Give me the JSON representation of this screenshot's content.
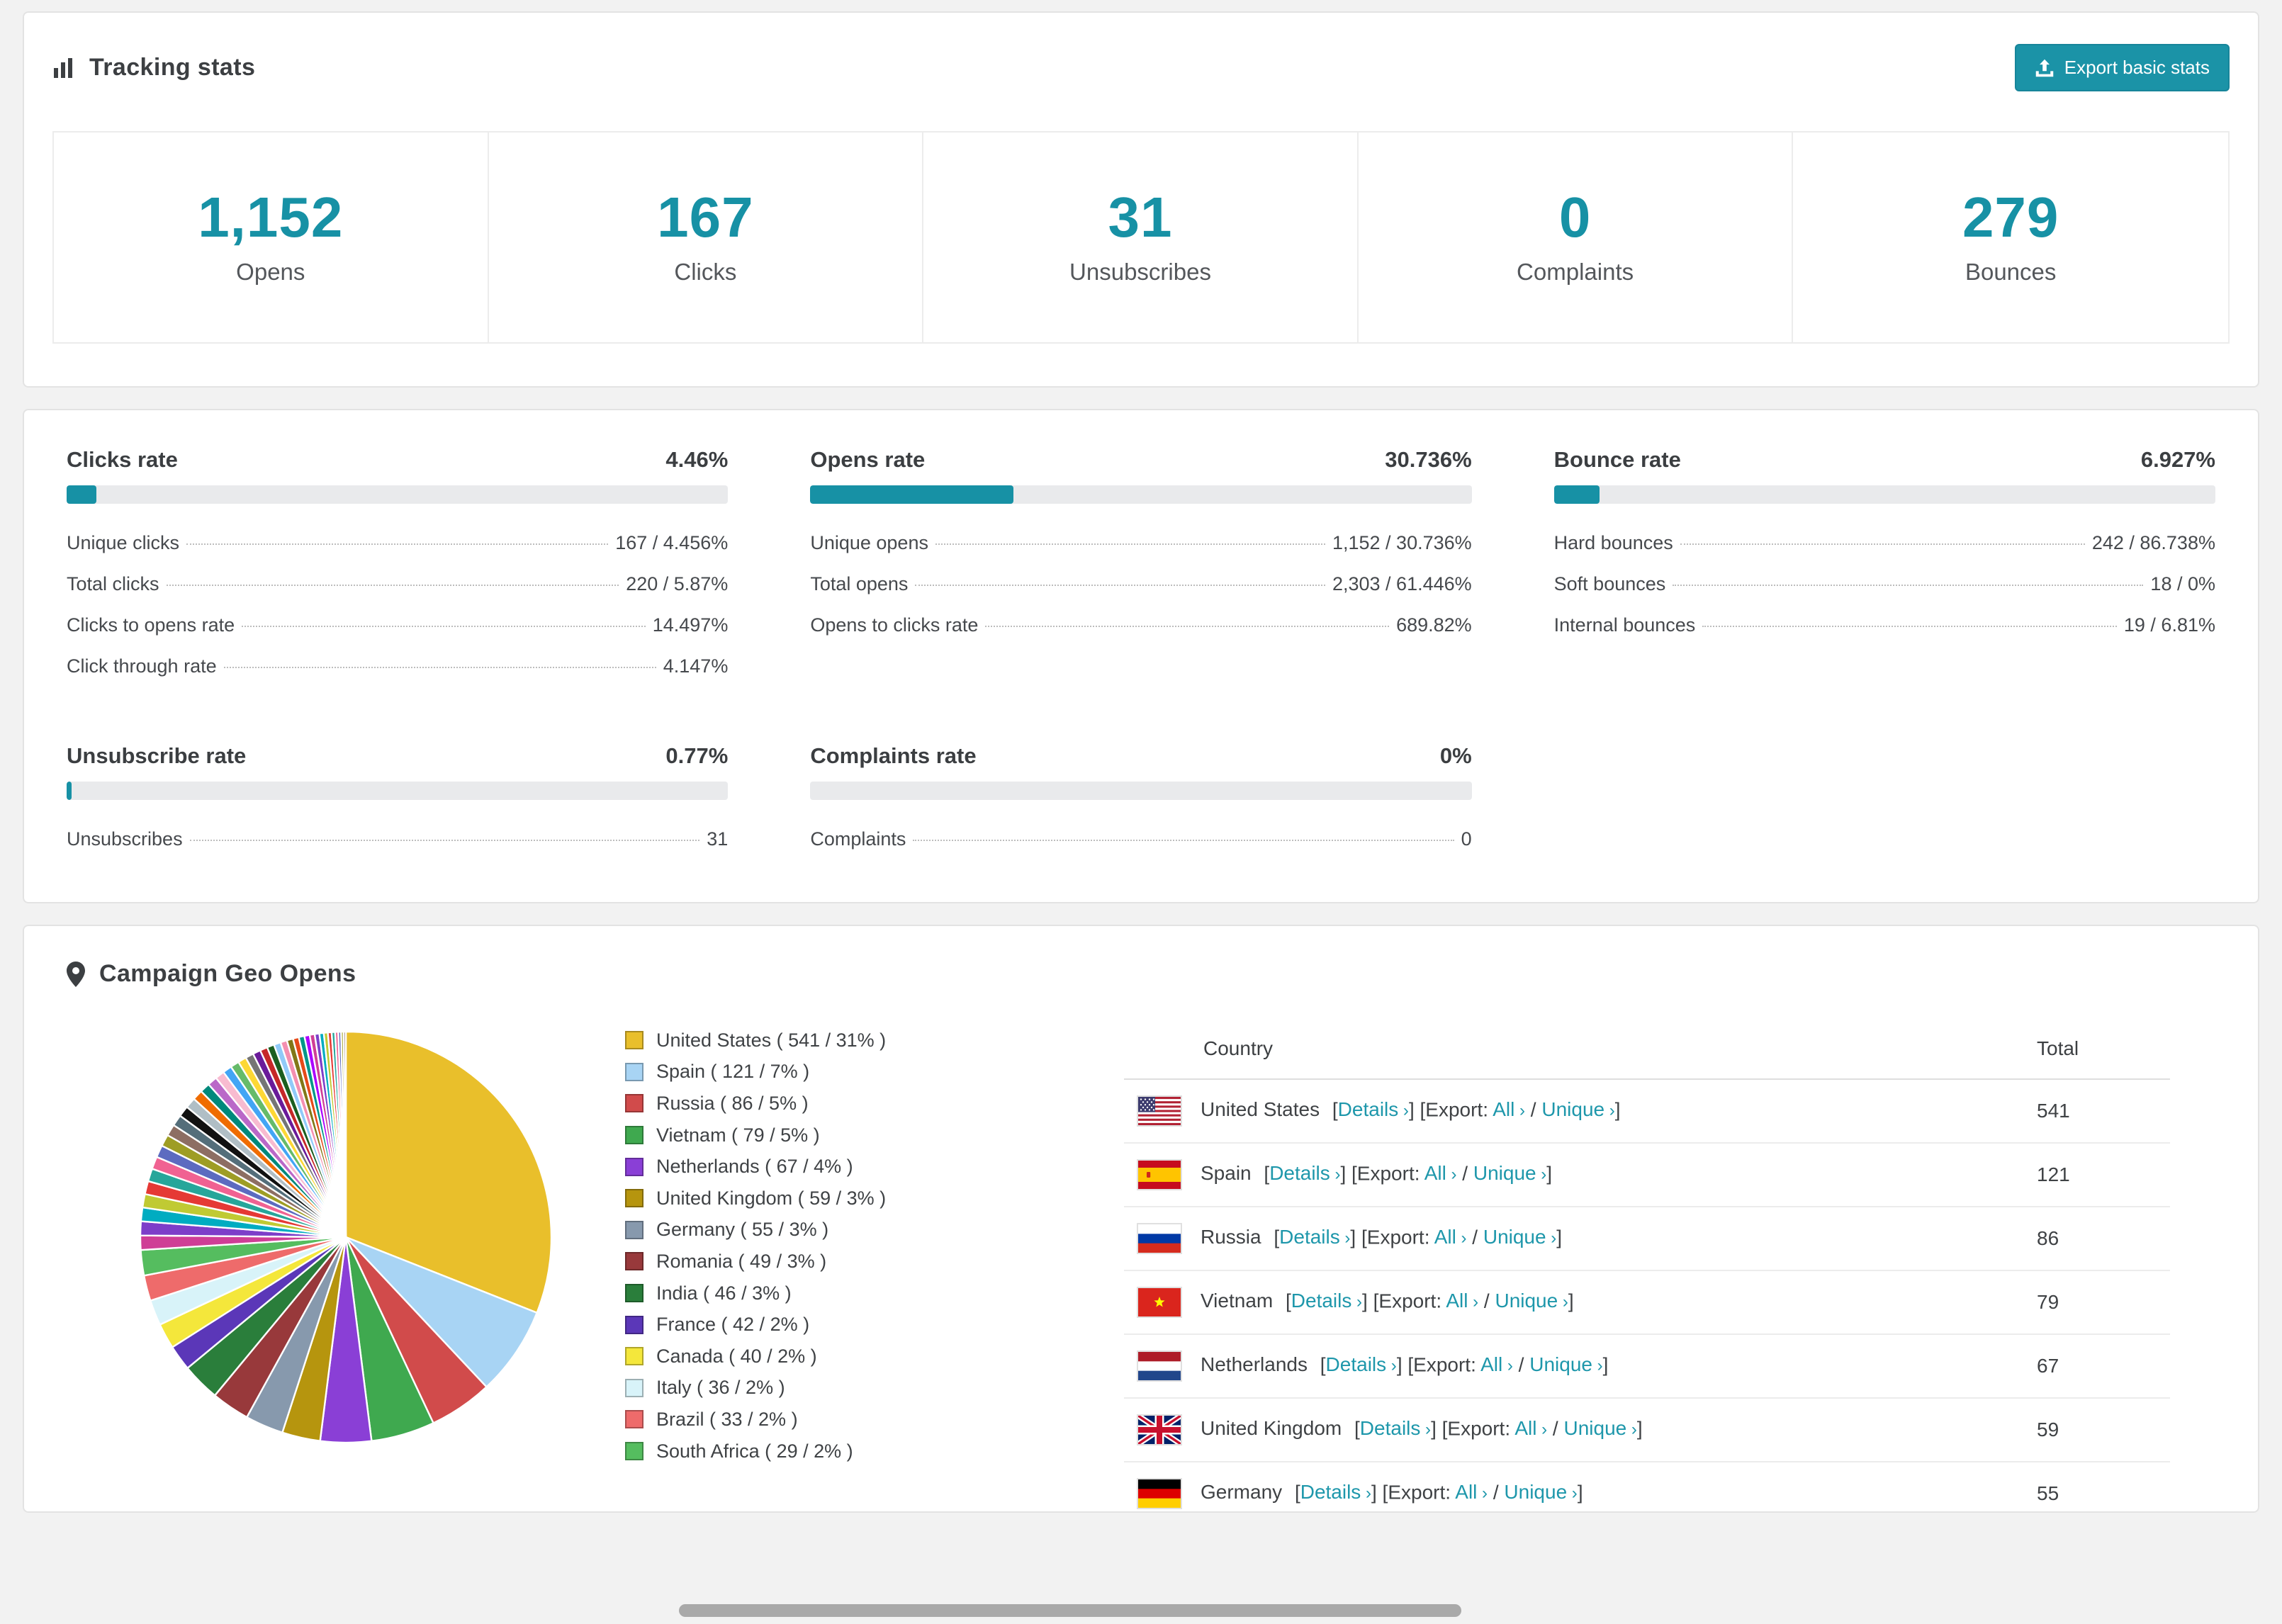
{
  "theme": {
    "accent": "#1791a5",
    "link": "#1e97ab",
    "text": "#3f4245"
  },
  "tracking": {
    "title": "Tracking stats",
    "export_button_label": "Export basic stats",
    "stats": [
      {
        "value": "1,152",
        "label": "Opens"
      },
      {
        "value": "167",
        "label": "Clicks"
      },
      {
        "value": "31",
        "label": "Unsubscribes"
      },
      {
        "value": "0",
        "label": "Complaints"
      },
      {
        "value": "279",
        "label": "Bounces"
      }
    ]
  },
  "rates": [
    {
      "title": "Clicks rate",
      "value": "4.46%",
      "pct": 4.46,
      "rows": [
        {
          "label": "Unique clicks",
          "value": "167 / 4.456%"
        },
        {
          "label": "Total clicks",
          "value": "220 / 5.87%"
        },
        {
          "label": "Clicks to opens rate",
          "value": "14.497%"
        },
        {
          "label": "Click through rate",
          "value": "4.147%"
        }
      ]
    },
    {
      "title": "Opens rate",
      "value": "30.736%",
      "pct": 30.736,
      "rows": [
        {
          "label": "Unique opens",
          "value": "1,152 / 30.736%"
        },
        {
          "label": "Total opens",
          "value": "2,303 / 61.446%"
        },
        {
          "label": "Opens to clicks rate",
          "value": "689.82%"
        }
      ]
    },
    {
      "title": "Bounce rate",
      "value": "6.927%",
      "pct": 6.927,
      "rows": [
        {
          "label": "Hard bounces",
          "value": "242 / 86.738%"
        },
        {
          "label": "Soft bounces",
          "value": "18 / 0%"
        },
        {
          "label": "Internal bounces",
          "value": "19 / 6.81%"
        }
      ]
    },
    {
      "title": "Unsubscribe rate",
      "value": "0.77%",
      "pct": 0.77,
      "rows": [
        {
          "label": "Unsubscribes",
          "value": "31"
        }
      ]
    },
    {
      "title": "Complaints rate",
      "value": "0%",
      "pct": 0,
      "rows": [
        {
          "label": "Complaints",
          "value": "0"
        }
      ]
    }
  ],
  "geo": {
    "title": "Campaign Geo Opens",
    "table_headers": {
      "country": "Country",
      "total": "Total"
    },
    "link_labels": {
      "details": "Details",
      "export": "Export:",
      "all": "All",
      "unique": "Unique"
    },
    "rows": [
      {
        "flag": "us",
        "country": "United States",
        "total": "541"
      },
      {
        "flag": "es",
        "country": "Spain",
        "total": "121"
      },
      {
        "flag": "ru",
        "country": "Russia",
        "total": "86"
      },
      {
        "flag": "vn",
        "country": "Vietnam",
        "total": "79"
      },
      {
        "flag": "nl",
        "country": "Netherlands",
        "total": "67"
      },
      {
        "flag": "gb",
        "country": "United Kingdom",
        "total": "59"
      },
      {
        "flag": "de",
        "country": "Germany",
        "total": "55"
      }
    ]
  },
  "chart_data": {
    "type": "pie",
    "title": "Campaign Geo Opens",
    "legend_position": "right",
    "slices": [
      {
        "label": "United States",
        "count": 541,
        "pct": 31,
        "color": "#e9bf2b"
      },
      {
        "label": "Spain",
        "count": 121,
        "pct": 7,
        "color": "#a8d4f4"
      },
      {
        "label": "Russia",
        "count": 86,
        "pct": 5,
        "color": "#d14b4b"
      },
      {
        "label": "Vietnam",
        "count": 79,
        "pct": 5,
        "color": "#3fa94f"
      },
      {
        "label": "Netherlands",
        "count": 67,
        "pct": 4,
        "color": "#8a3fd6"
      },
      {
        "label": "United Kingdom",
        "count": 59,
        "pct": 3,
        "color": "#b6950e"
      },
      {
        "label": "Germany",
        "count": 55,
        "pct": 3,
        "color": "#8799ad"
      },
      {
        "label": "Romania",
        "count": 49,
        "pct": 3,
        "color": "#98393b"
      },
      {
        "label": "India",
        "count": 46,
        "pct": 3,
        "color": "#2a7e3b"
      },
      {
        "label": "France",
        "count": 42,
        "pct": 2,
        "color": "#5b37b8"
      },
      {
        "label": "Canada",
        "count": 40,
        "pct": 2,
        "color": "#f4e73b"
      },
      {
        "label": "Italy",
        "count": 36,
        "pct": 2,
        "color": "#d8f3f9"
      },
      {
        "label": "Brazil",
        "count": 33,
        "pct": 2,
        "color": "#ee6b6b"
      },
      {
        "label": "South Africa",
        "count": 29,
        "pct": 2,
        "color": "#55bd5f"
      }
    ],
    "others": {
      "pct": 26,
      "approx_slice_count": 40,
      "palette": [
        "#cf3e96",
        "#7d3ec9",
        "#00acc1",
        "#c0ca33",
        "#e53935",
        "#26a69a",
        "#f06292",
        "#5c6bc0",
        "#9e9d24",
        "#8d6e63",
        "#546e7a",
        "#111111",
        "#b0bec5",
        "#ef6c00",
        "#00897b",
        "#ba68c8",
        "#f8bbd0",
        "#42a5f5",
        "#66bb6a",
        "#fdd835",
        "#757575",
        "#6a1b9a",
        "#c62828",
        "#1b5e20",
        "#90caf9",
        "#f48fb1",
        "#827717",
        "#e64a19",
        "#009688",
        "#aa00ff"
      ]
    }
  }
}
